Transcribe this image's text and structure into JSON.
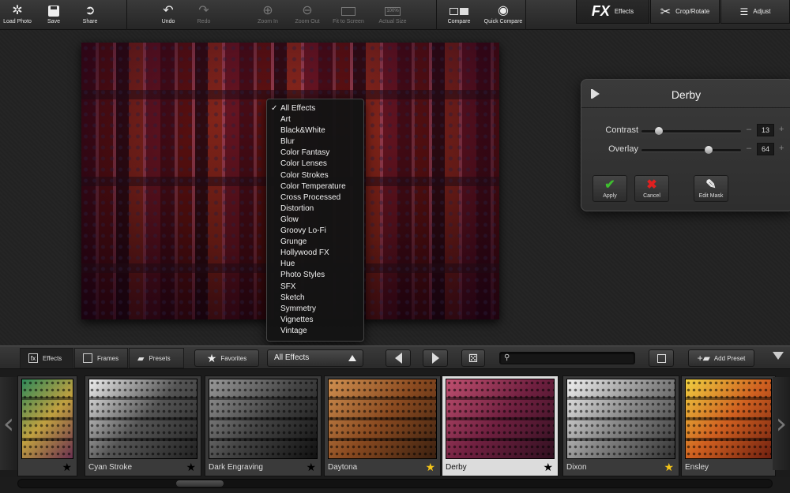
{
  "toolbar": {
    "load_photo": "Load Photo",
    "save": "Save",
    "share": "Share",
    "undo": "Undo",
    "redo": "Redo",
    "zoom_in": "Zoom In",
    "zoom_out": "Zoom Out",
    "fit_to_screen": "Fit to Screen",
    "actual_size": "Actual Size",
    "actual_size_badge": "100%",
    "compare": "Compare",
    "quick_compare": "Quick Compare"
  },
  "modes": {
    "effects_big": "FX",
    "effects": "Effects",
    "crop_rotate": "Crop/Rotate",
    "adjust": "Adjust"
  },
  "dropdown": {
    "items": [
      "All Effects",
      "Art",
      "Black&White",
      "Blur",
      "Color Fantasy",
      "Color Lenses",
      "Color Strokes",
      "Color Temperature",
      "Cross Processed",
      "Distortion",
      "Glow",
      "Groovy Lo-Fi",
      "Grunge",
      "Hollywood FX",
      "Hue",
      "Photo Styles",
      "SFX",
      "Sketch",
      "Symmetry",
      "Vignettes",
      "Vintage"
    ],
    "checked_index": 0
  },
  "panel": {
    "title": "Derby",
    "contrast_label": "Contrast",
    "contrast_value": "13",
    "contrast_level": 0.13,
    "overlay_label": "Overlay",
    "overlay_value": "64",
    "overlay_level": 0.64,
    "apply": "Apply",
    "cancel": "Cancel",
    "edit_mask": "Edit Mask"
  },
  "bottom": {
    "tab_effects": "Effects",
    "tab_frames": "Frames",
    "tab_presets": "Presets",
    "favorites": "Favorites",
    "filter_selected": "All Effects",
    "search_placeholder": "",
    "add_preset": "Add Preset"
  },
  "thumbnails": [
    {
      "name": "",
      "star": "black"
    },
    {
      "name": "Cyan Stroke",
      "star": "black"
    },
    {
      "name": "Dark Engraving",
      "star": "black"
    },
    {
      "name": "Daytona",
      "star": "gold"
    },
    {
      "name": "Derby",
      "star": "black",
      "selected": true
    },
    {
      "name": "Dixon",
      "star": "gold"
    },
    {
      "name": "Ensley",
      "star": "none"
    }
  ],
  "colors": {
    "star_gold": "#f5c518",
    "apply_green": "#3fbf2f",
    "cancel_red": "#e02020"
  }
}
